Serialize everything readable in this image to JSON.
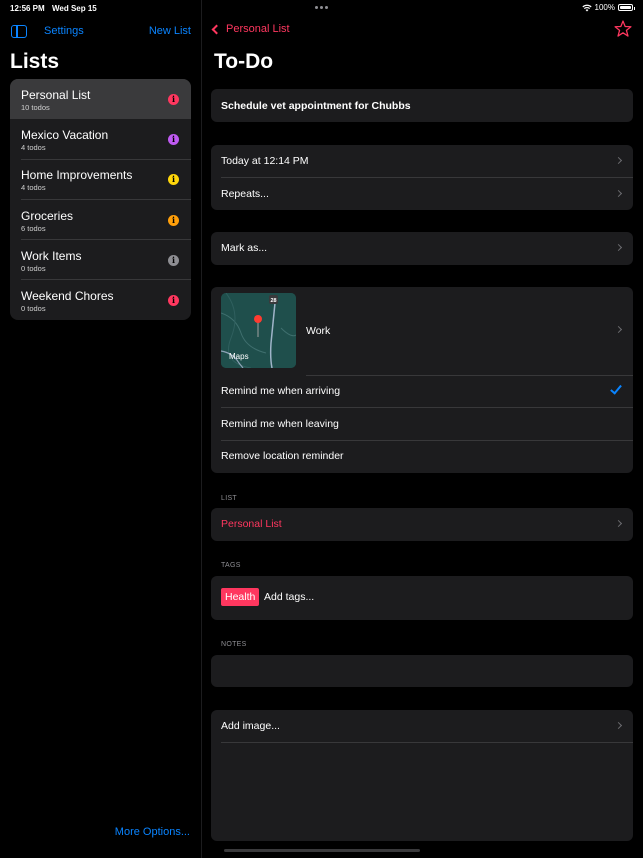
{
  "status_bar": {
    "time": "12:56 PM",
    "date": "Wed Sep 15",
    "battery": "100%",
    "battery_level": 1.0
  },
  "sidebar": {
    "settings_label": "Settings",
    "new_list_label": "New List",
    "title": "Lists",
    "more_options_label": "More Options...",
    "lists": [
      {
        "name": "Personal List",
        "count": "10 todos",
        "color": "#ff375f",
        "selected": true
      },
      {
        "name": "Mexico Vacation",
        "count": "4 todos",
        "color": "#bf5af2",
        "selected": false
      },
      {
        "name": "Home Improvements",
        "count": "4 todos",
        "color": "#ffd60a",
        "selected": false
      },
      {
        "name": "Groceries",
        "count": "6 todos",
        "color": "#ff9f0a",
        "selected": false
      },
      {
        "name": "Work Items",
        "count": "0 todos",
        "color": "#8e8e93",
        "selected": false
      },
      {
        "name": "Weekend Chores",
        "count": "0 todos",
        "color": "#ff375f",
        "selected": false
      }
    ]
  },
  "detail": {
    "back_label": "Personal List",
    "title": "To-Do",
    "todo_title": "Schedule vet appointment for Chubbs",
    "due_date": "Today at 12:14 PM",
    "repeats_label": "Repeats...",
    "mark_as_label": "Mark as...",
    "location": {
      "name": "Work",
      "map_badge": "Maps",
      "road_marker": "28",
      "options": [
        {
          "label": "Remind me when arriving",
          "checked": true
        },
        {
          "label": "Remind me when leaving",
          "checked": false
        },
        {
          "label": "Remove location reminder",
          "checked": false
        }
      ]
    },
    "list_section": {
      "header": "LIST",
      "value": "Personal List"
    },
    "tags_section": {
      "header": "TAGS",
      "tags": [
        "Health"
      ],
      "add_label": "Add tags..."
    },
    "notes_section": {
      "header": "NOTES",
      "value": ""
    },
    "add_image_label": "Add image..."
  },
  "colors": {
    "accent_blue": "#0a84ff",
    "accent_pink": "#ff375f",
    "card_bg": "#1c1c1e"
  }
}
